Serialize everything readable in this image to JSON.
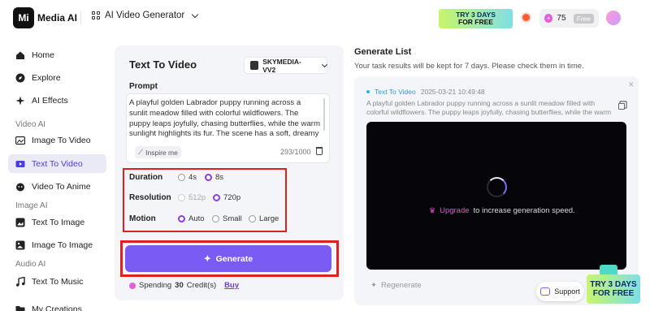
{
  "header": {
    "logo_text": "Mi",
    "app_name": "Media AI",
    "breadcrumb": "AI Video Generator",
    "promo_line1": "TRY 3 DAYS",
    "promo_line2": "FOR FREE",
    "credits": "75",
    "free_badge": "Free"
  },
  "sidebar": {
    "items": [
      {
        "label": "Home",
        "icon": "home-icon"
      },
      {
        "label": "Explore",
        "icon": "compass-icon"
      },
      {
        "label": "AI Effects",
        "icon": "sparkle-icon"
      }
    ],
    "sections": [
      {
        "title": "Video AI",
        "items": [
          {
            "label": "Image To Video",
            "icon": "image-video-icon"
          },
          {
            "label": "Text To Video",
            "icon": "text-video-icon",
            "active": true
          },
          {
            "label": "Video To Anime",
            "icon": "anime-icon"
          }
        ]
      },
      {
        "title": "Image AI",
        "items": [
          {
            "label": "Text To Image",
            "icon": "text-image-icon"
          },
          {
            "label": "Image To Image",
            "icon": "image-image-icon"
          }
        ]
      },
      {
        "title": "Audio AI",
        "items": [
          {
            "label": "Text To Music",
            "icon": "music-icon"
          }
        ]
      }
    ],
    "bottom_item": "My Creations"
  },
  "panel": {
    "title": "Text To Video",
    "model": "SKYMEDIA-VV2",
    "prompt_label": "Prompt",
    "prompt_text": "A playful golden Labrador puppy running across a sunlit meadow filled with colorful wildflowers. The puppy leaps joyfully, chasing butterflies, while the warm sunlight highlights its fur. The scene has a soft, dreamy feel with gentle camera movement and a light bokeh effect in the",
    "inspire_label": "Inspire me",
    "char_count": "293/1000",
    "duration_label": "Duration",
    "duration_options": [
      "4s",
      "8s"
    ],
    "duration_selected": "8s",
    "resolution_label": "Resolution",
    "resolution_options": [
      "512p",
      "720p"
    ],
    "resolution_selected": "720p",
    "motion_label": "Motion",
    "motion_options": [
      "Auto",
      "Small",
      "Large"
    ],
    "motion_selected": "Auto",
    "generate_label": "Generate",
    "spending_prefix": "Spending",
    "spending_amount": "30",
    "spending_suffix": "Credit(s)",
    "buy_label": "Buy"
  },
  "results": {
    "title": "Generate List",
    "subtitle": "Your task results will be kept for 7 days. Please check them in time.",
    "task_name": "Text To Video",
    "task_time": "2025-03-21 10:49:48",
    "task_prompt": "A playful golden Labrador puppy running across a sunlit meadow filled with colorful wildflowers. The puppy leaps joyfully, chasing butterflies, while the warm sunlight highlights ...",
    "upgrade_label": "Upgrade",
    "upgrade_suffix": "to increase generation speed.",
    "regenerate_label": "Regenerate",
    "support_label": "Support",
    "promo_line1": "TRY 3 DAYS",
    "promo_line2": "FOR FREE"
  },
  "colors": {
    "accent": "#7a5cf5",
    "highlight_frame": "#e02020",
    "link": "#6a3de8"
  }
}
